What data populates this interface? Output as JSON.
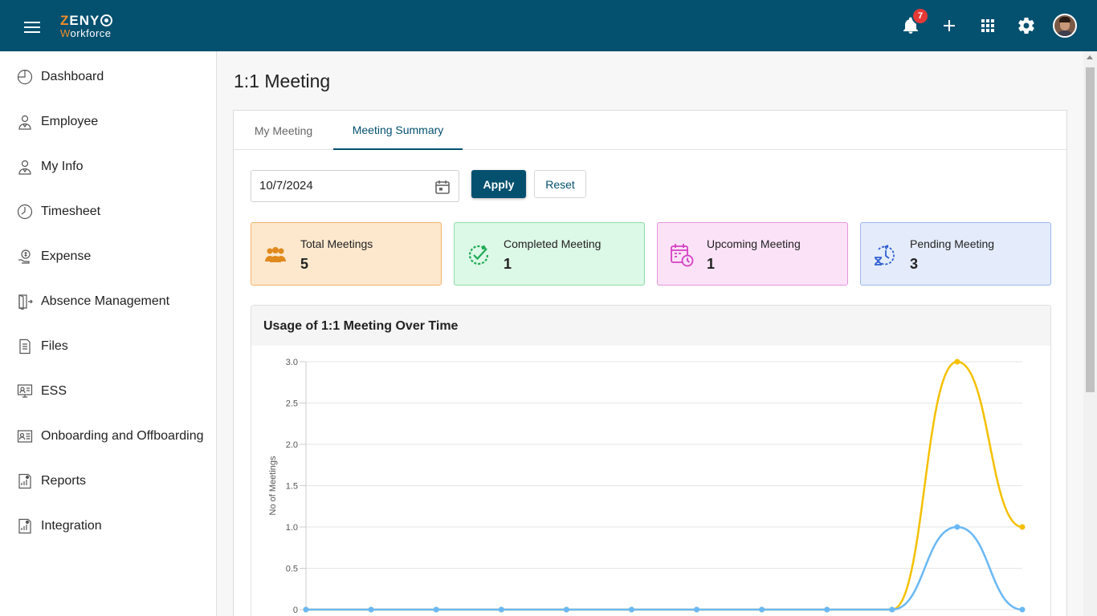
{
  "app": {
    "logo_top": "ZENY",
    "logo_bottom_rest": "orkforce",
    "logo_bottom_first": "W",
    "notification_count": "7",
    "icons": [
      "menu-icon",
      "bell-icon",
      "plus-icon",
      "apps-grid-icon",
      "gear-icon",
      "avatar"
    ]
  },
  "sidebar": {
    "items": [
      {
        "label": "Dashboard",
        "icon": "dashboard-icon"
      },
      {
        "label": "Employee",
        "icon": "employee-icon"
      },
      {
        "label": "My Info",
        "icon": "my-info-icon"
      },
      {
        "label": "Timesheet",
        "icon": "clock-icon"
      },
      {
        "label": "Expense",
        "icon": "expense-icon"
      },
      {
        "label": "Absence Management",
        "icon": "door-exit-icon"
      },
      {
        "label": "Files",
        "icon": "file-icon"
      },
      {
        "label": "ESS",
        "icon": "ess-icon"
      },
      {
        "label": "Onboarding and Offboarding",
        "icon": "id-card-icon"
      },
      {
        "label": "Reports",
        "icon": "report-icon"
      },
      {
        "label": "Integration",
        "icon": "integration-icon"
      }
    ]
  },
  "main": {
    "title": "1:1 Meeting",
    "tabs": [
      {
        "label": "My Meeting",
        "active": false
      },
      {
        "label": "Meeting Summary",
        "active": true
      }
    ],
    "filter": {
      "date_value": "10/7/2024",
      "apply_label": "Apply",
      "reset_label": "Reset"
    },
    "stats": [
      {
        "label": "Total Meetings",
        "value": "5",
        "icon": "group-icon",
        "color": "#e08a1e"
      },
      {
        "label": "Completed Meeting",
        "value": "1",
        "icon": "check-clock-icon",
        "color": "#1faa55"
      },
      {
        "label": "Upcoming Meeting",
        "value": "1",
        "icon": "calendar-clock-icon",
        "color": "#d43fc4"
      },
      {
        "label": "Pending Meeting",
        "value": "3",
        "icon": "hourglass-clock-icon",
        "color": "#2f5fd0"
      }
    ],
    "chart_title": "Usage of 1:1 Meeting Over Time"
  },
  "chart_data": {
    "type": "line",
    "ylabel": "No of Meetings",
    "ylim": [
      0,
      3.0
    ],
    "yticks": [
      "0",
      "0.5",
      "1.0",
      "1.5",
      "2.0",
      "2.5",
      "3.0"
    ],
    "x": [
      1,
      2,
      3,
      4,
      5,
      6,
      7,
      8,
      9,
      10,
      11,
      12
    ],
    "series": [
      {
        "color": "#f5c000",
        "values": [
          0,
          0,
          0,
          0,
          0,
          0,
          0,
          0,
          0,
          0,
          3,
          1
        ]
      },
      {
        "color": "#6ab8f5",
        "values": [
          0,
          0,
          0,
          0,
          0,
          0,
          0,
          0,
          0,
          0,
          1,
          0
        ]
      }
    ],
    "grid": true
  }
}
